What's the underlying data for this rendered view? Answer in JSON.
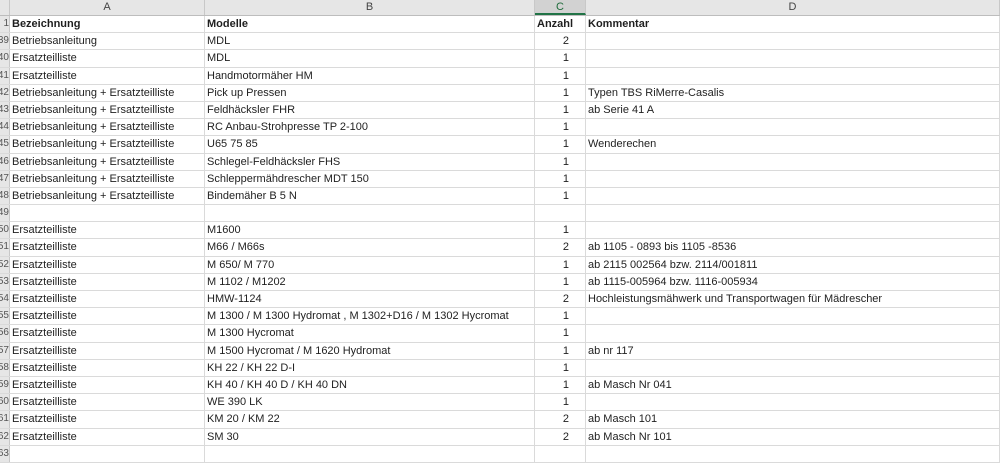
{
  "columns": [
    "A",
    "B",
    "C",
    "D"
  ],
  "header_row": {
    "num": "1",
    "a": "Bezeichnung",
    "b": "Modelle",
    "c": "Anzahl",
    "d": "Kommentar"
  },
  "rows": [
    {
      "num": "39",
      "a": "Betriebsanleitung",
      "b": "MDL",
      "c": "2",
      "d": ""
    },
    {
      "num": "40",
      "a": "Ersatzteilliste",
      "b": "MDL",
      "c": "1",
      "d": ""
    },
    {
      "num": "41",
      "a": "Ersatzteilliste",
      "b": "Handmotormäher HM",
      "c": "1",
      "d": ""
    },
    {
      "num": "42",
      "a": "Betriebsanleitung + Ersatzteilliste",
      "b": "Pick up Pressen",
      "c": "1",
      "d": "Typen TBS RiMerre-Casalis"
    },
    {
      "num": "43",
      "a": "Betriebsanleitung + Ersatzteilliste",
      "b": "Feldhäcksler FHR",
      "c": "1",
      "d": "ab Serie 41 A"
    },
    {
      "num": "44",
      "a": "Betriebsanleitung + Ersatzteilliste",
      "b": "RC Anbau-Strohpresse TP 2-100",
      "c": "1",
      "d": ""
    },
    {
      "num": "45",
      "a": "Betriebsanleitung + Ersatzteilliste",
      "b": "U65 75 85",
      "c": "1",
      "d": "Wenderechen"
    },
    {
      "num": "46",
      "a": "Betriebsanleitung + Ersatzteilliste",
      "b": "Schlegel-Feldhäcksler FHS",
      "c": "1",
      "d": ""
    },
    {
      "num": "47",
      "a": "Betriebsanleitung + Ersatzteilliste",
      "b": "Schleppermähdrescher MDT 150",
      "c": "1",
      "d": ""
    },
    {
      "num": "48",
      "a": "Betriebsanleitung + Ersatzteilliste",
      "b": "Bindemäher B 5 N",
      "c": "1",
      "d": ""
    },
    {
      "num": "49",
      "a": "",
      "b": "",
      "c": "",
      "d": ""
    },
    {
      "num": "50",
      "a": "Ersatzteilliste",
      "b": "M1600",
      "c": "1",
      "d": ""
    },
    {
      "num": "51",
      "a": "Ersatzteilliste",
      "b": "M66 / M66s",
      "c": "2",
      "d": "ab 1105 - 0893 bis 1105 -8536"
    },
    {
      "num": "52",
      "a": "Ersatzteilliste",
      "b": "M 650/ M 770",
      "c": "1",
      "d": "ab 2115 002564 bzw. 2114/001811"
    },
    {
      "num": "53",
      "a": "Ersatzteilliste",
      "b": "M 1102 / M1202",
      "c": "1",
      "d": "ab 1115-005964 bzw. 1116-005934"
    },
    {
      "num": "54",
      "a": "Ersatzteilliste",
      "b": "HMW-1124",
      "c": "2",
      "d": "Hochleistungsmähwerk und Transportwagen für Mädrescher"
    },
    {
      "num": "55",
      "a": "Ersatzteilliste",
      "b": "M 1300 / M 1300 Hydromat , M 1302+D16 / M 1302 Hycromat",
      "c": "1",
      "d": ""
    },
    {
      "num": "56",
      "a": "Ersatzteilliste",
      "b": "M 1300 Hycromat",
      "c": "1",
      "d": ""
    },
    {
      "num": "57",
      "a": "Ersatzteilliste",
      "b": "M 1500 Hycromat / M 1620 Hydromat",
      "c": "1",
      "d": "ab nr 117"
    },
    {
      "num": "58",
      "a": "Ersatzteilliste",
      "b": "KH 22 / KH 22 D-I",
      "c": "1",
      "d": ""
    },
    {
      "num": "59",
      "a": "Ersatzteilliste",
      "b": "KH 40 / KH 40 D / KH 40 DN",
      "c": "1",
      "d": "ab Masch Nr 041"
    },
    {
      "num": "60",
      "a": "Ersatzteilliste",
      "b": "WE 390 LK",
      "c": "1",
      "d": ""
    },
    {
      "num": "61",
      "a": "Ersatzteilliste",
      "b": "KM 20 / KM 22",
      "c": "2",
      "d": "ab Masch 101"
    },
    {
      "num": "62",
      "a": "Ersatzteilliste",
      "b": "SM 30",
      "c": "2",
      "d": "ab Masch Nr 101"
    },
    {
      "num": "63",
      "a": "",
      "b": "",
      "c": "",
      "d": ""
    }
  ]
}
